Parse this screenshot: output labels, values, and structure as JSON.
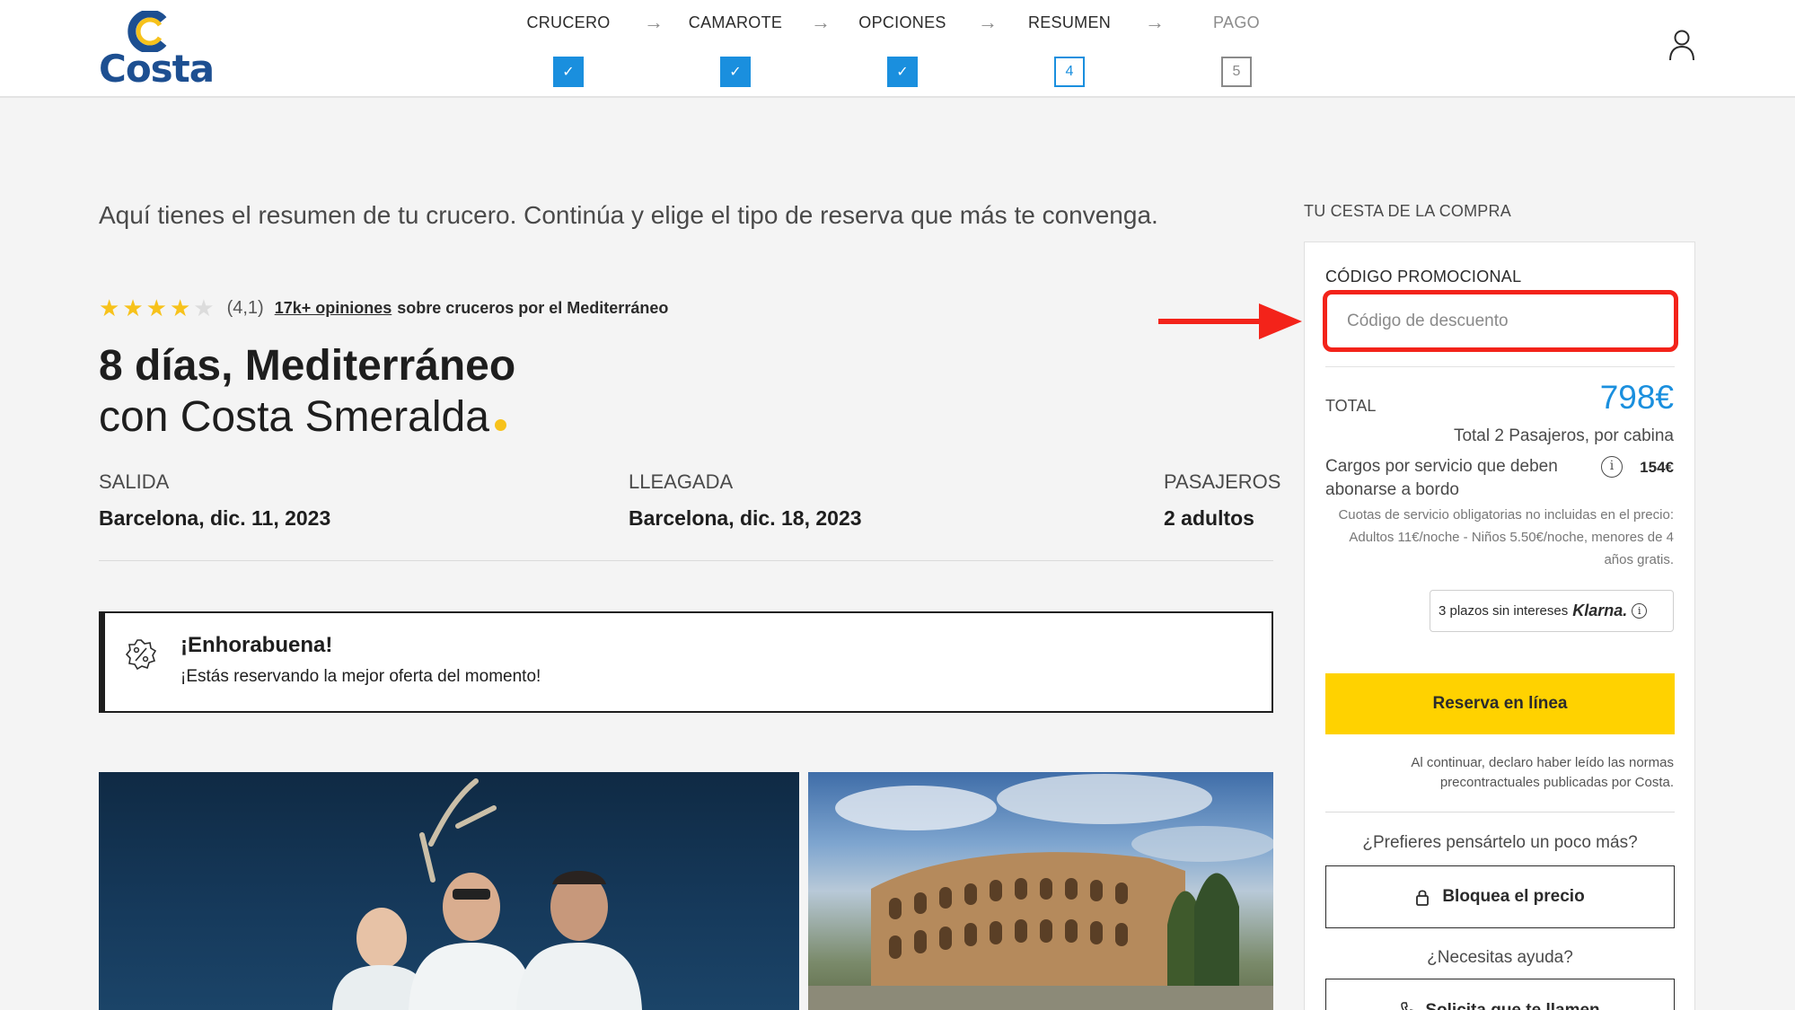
{
  "header": {
    "logo_text": "Costa",
    "steps": [
      {
        "label": "CRUCERO",
        "state": "done",
        "box": "✓"
      },
      {
        "label": "CAMAROTE",
        "state": "done",
        "box": "✓"
      },
      {
        "label": "OPCIONES",
        "state": "done",
        "box": "✓"
      },
      {
        "label": "RESUMEN",
        "state": "current",
        "box": "4"
      },
      {
        "label": "PAGO",
        "state": "next",
        "box": "5"
      }
    ],
    "arrow_glyph": "→"
  },
  "main": {
    "intro": "Aquí tienes el resumen de tu crucero. Continúa y elige el tipo de reserva que más te convenga.",
    "rating": {
      "stars": 4,
      "max": 5,
      "score": "(4,1)",
      "reviews": "17k+ opiniones",
      "rest": "sobre cruceros por el Mediterráneo"
    },
    "title_line1": "8 días, Mediterráneo",
    "title_line2": "con Costa Smeralda",
    "departure": {
      "label": "SALIDA",
      "value": "Barcelona, dic. 11, 2023"
    },
    "arrival": {
      "label": "LLEAGADA",
      "value": "Barcelona, dic. 18, 2023"
    },
    "passengers": {
      "label": "PASAJEROS",
      "value": "2 adultos"
    },
    "promo": {
      "heading": "¡Enhorabuena!",
      "subtext": "¡Estás reservando la mejor oferta del momento!"
    }
  },
  "cart": {
    "title": "TU CESTA DE LA COMPRA",
    "promo_label": "CÓDIGO PROMOCIONAL",
    "promo_placeholder": "Código de descuento",
    "total_label": "TOTAL",
    "total_value": "798€",
    "passengers_note": "Total 2 Pasajeros, por cabina",
    "fees_label": "Cargos por servicio que deben abonarse a bordo",
    "fees_value": "154€",
    "fees_note": "Cuotas de servicio obligatorias no incluidas en el precio: Adultos 11€/noche - Niños 5.50€/noche, menores de 4 años gratis.",
    "klarna_text": "3 plazos sin intereses",
    "klarna_brand": "Klarna.",
    "book_button": "Reserva en línea",
    "legal": "Al continuar, declaro haber leído las normas precontractuales publicadas por Costa.",
    "question1": "¿Prefieres pensártelo un poco más?",
    "lock_button": "Bloquea el precio",
    "question2": "¿Necesitas ayuda?",
    "call_button": "Solicita que te llamen"
  },
  "colors": {
    "accent_blue": "#1a8fde",
    "brand_yellow": "#ffd200",
    "highlight_red": "#f3231a",
    "logo_blue": "#1d4f91"
  }
}
